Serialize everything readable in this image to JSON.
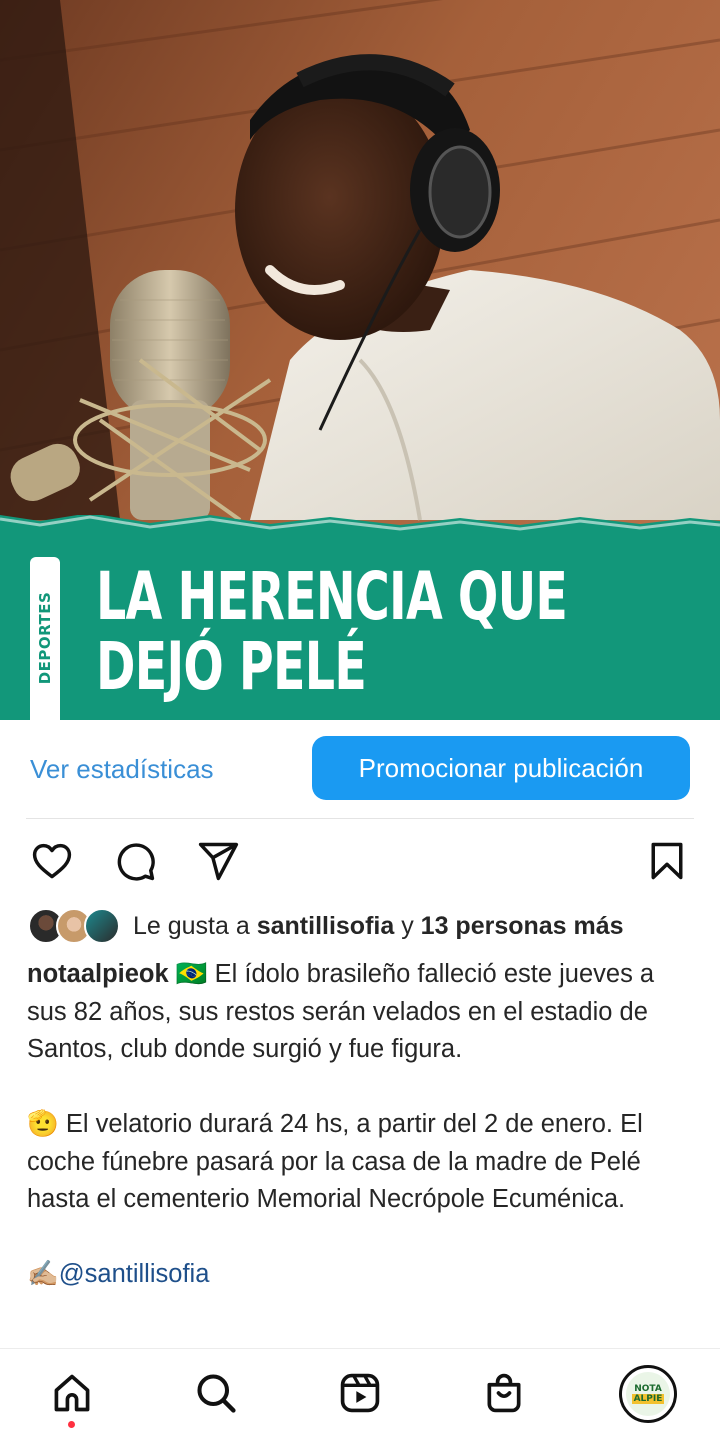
{
  "post": {
    "category_tag": "DEPORTES",
    "headline_line1": "LA HERENCIA QUE",
    "headline_line2": "DEJÓ PELÉ"
  },
  "actions": {
    "stats_label": "Ver estadísticas",
    "promote_label": "Promocionar publicación"
  },
  "icons": {
    "like": "heart-icon",
    "comment": "comment-icon",
    "share": "paper-plane-icon",
    "save": "bookmark-icon"
  },
  "likes": {
    "prefix": "Le gusta a",
    "user": "santillisofia",
    "connector": "y",
    "others": "13 personas más"
  },
  "caption": {
    "username": "notaalpieok",
    "flag_emoji": "🇧🇷",
    "paragraph1": "El ídolo brasileño falleció este jueves a sus 82 años, sus restos serán velados en el estadio de Santos, club donde surgió y fue figura.",
    "emoji2": "🫡",
    "paragraph2": "El velatorio durará 24 hs, a partir del 2 de enero. El coche fúnebre pasará por la casa de la madre de Pelé hasta el cementerio Memorial Necrópole Ecuménica.",
    "emoji3": "✍🏼",
    "mention": "@santillisofia"
  },
  "nav": {
    "items": [
      "home-icon",
      "search-icon",
      "reels-icon",
      "shop-icon",
      "profile-avatar"
    ],
    "profile_line1": "NOTA",
    "profile_line2": "ALPIE"
  },
  "colors": {
    "banner_green": "#12977a",
    "promo_blue": "#1a9af2",
    "link_blue": "#3a8fd6",
    "mention_blue": "#1e4f8a",
    "notification_red": "#ff3040"
  }
}
